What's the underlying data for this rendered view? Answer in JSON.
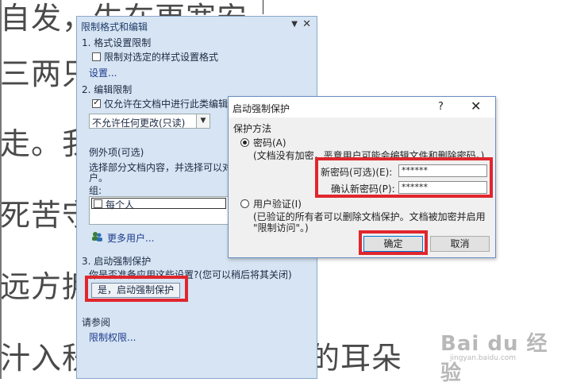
{
  "document": {
    "lines": [
      "自发，生在更宽安",
      "三两只          了铜锣。",
      "走。我",
      "死苦守",
      "远方拥",
      "汁入秋。疾风灌满了他的耳朵"
    ],
    "para_mark": "↵"
  },
  "pane": {
    "title": "限制格式和编辑",
    "menu_arrow": "▼",
    "close": "✕",
    "section1_heading": "1. 格式设置限制",
    "format_checkbox_label": "限制对选定的样式设置格式",
    "format_settings_link": "设置...",
    "section2_heading": "2. 编辑限制",
    "edit_checkbox_label": "仅允许在文档中进行此类编辑",
    "edit_select_value": "不允许任何更改(只读)",
    "exceptions_heading": "例外项(可选)",
    "exceptions_desc_line1": "选择部分文档内容，并选择可以对",
    "exceptions_desc_line2": "户。",
    "group_label": "组:",
    "group_item": "每个人",
    "more_users_link": "更多用户...",
    "section3_heading": "3. 启动强制保护",
    "section3_question": "你是否准备应用这些设置?(您可以稍后将其关闭)",
    "start_button": "是，启动强制保护",
    "see_also_heading": "请参阅",
    "restrict_permission_link": "限制权限..."
  },
  "dialog": {
    "title": "启动强制保护",
    "help": "?",
    "close": "✕",
    "protect_method_label": "保护方法",
    "password_radio_label": "密码(A)",
    "password_desc": "(文档没有加密，恶意用户可能会编辑文件和删除密码。)",
    "new_password_label": "新密码(可选)(E):",
    "new_password_value": "******",
    "confirm_password_label": "确认新密码(P):",
    "confirm_password_value": "******",
    "user_auth_radio_label": "用户验证(I)",
    "user_auth_desc_line1": "(已验证的所有者可以删除文档保护。文档被加密并启用",
    "user_auth_desc_line2": "\"限制访问\"。)",
    "ok_button": "确定",
    "cancel_button": "取消"
  },
  "watermark": {
    "main": "Bai du 经验",
    "sub": "jingyan.baidu.com"
  },
  "colors": {
    "highlight_red": "#e0262d",
    "pane_bg": "#d6e4f3",
    "dialog_bg": "#f0f0f0"
  }
}
